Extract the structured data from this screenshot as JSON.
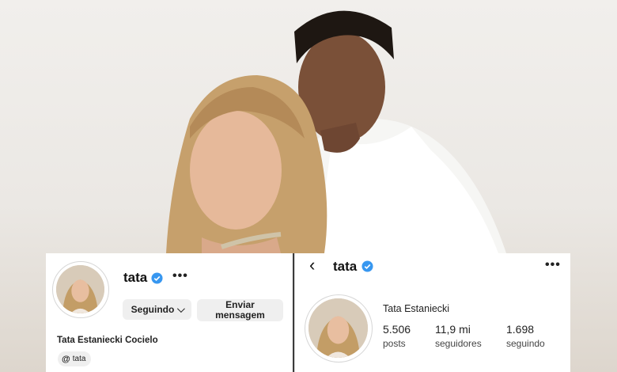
{
  "colors": {
    "verified": "#3797f0",
    "button_bg": "#efefef"
  },
  "left_profile": {
    "handle": "tata",
    "verified_icon": "verified-badge-icon",
    "more_icon": "more-options-icon",
    "more_label": "•••",
    "follow_button": "Seguindo",
    "message_button": "Enviar mensagem",
    "full_name": "Tata Estaniecki Cocielo",
    "threads_icon": "threads-icon",
    "threads_glyph": "@",
    "threads_label": "tata"
  },
  "right_profile": {
    "back_icon": "back-chevron-icon",
    "back_glyph": "‹",
    "handle": "tata",
    "verified_icon": "verified-badge-icon",
    "more_icon": "more-options-icon",
    "more_label": "•••",
    "display_name": "Tata Estaniecki",
    "stats": [
      {
        "value": "5.506",
        "label": "posts"
      },
      {
        "value": "11,9 mi",
        "label": "seguidores"
      },
      {
        "value": "1.698",
        "label": "seguindo"
      }
    ]
  }
}
